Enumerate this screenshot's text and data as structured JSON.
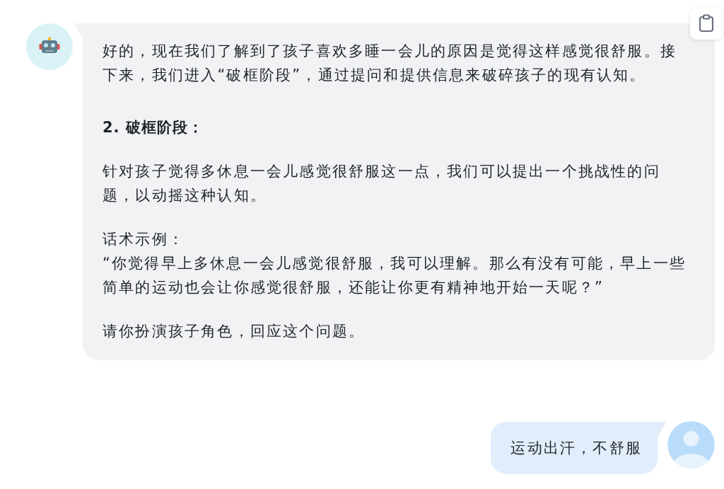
{
  "messages": [
    {
      "from_user": false,
      "blocks": [
        {
          "kind": "paragraph",
          "text": "好的，现在我们了解到了孩子喜欢多睡一会儿的原因是觉得这样感觉很舒服。接下来，我们进入“破框阶段”，通过提问和提供信息来破碎孩子的现有认知。"
        },
        {
          "kind": "heading",
          "text": "2. 破框阶段："
        },
        {
          "kind": "paragraph",
          "text": "针对孩子觉得多休息一会儿感觉很舒服这一点，我们可以提出一个挑战性的问题，以动摇这种认知。"
        },
        {
          "kind": "example",
          "label": "话术示例：",
          "text": "“你觉得早上多休息一会儿感觉很舒服，我可以理解。那么有没有可能，早上一些简单的运动也会让你感觉很舒服，还能让你更有精神地开始一天呢？”"
        },
        {
          "kind": "paragraph",
          "text": "请你扮演孩子角色，回应这个问题。"
        }
      ]
    },
    {
      "from_user": true,
      "blocks": [
        {
          "kind": "paragraph",
          "text": "运动出汗，不舒服"
        }
      ]
    }
  ]
}
